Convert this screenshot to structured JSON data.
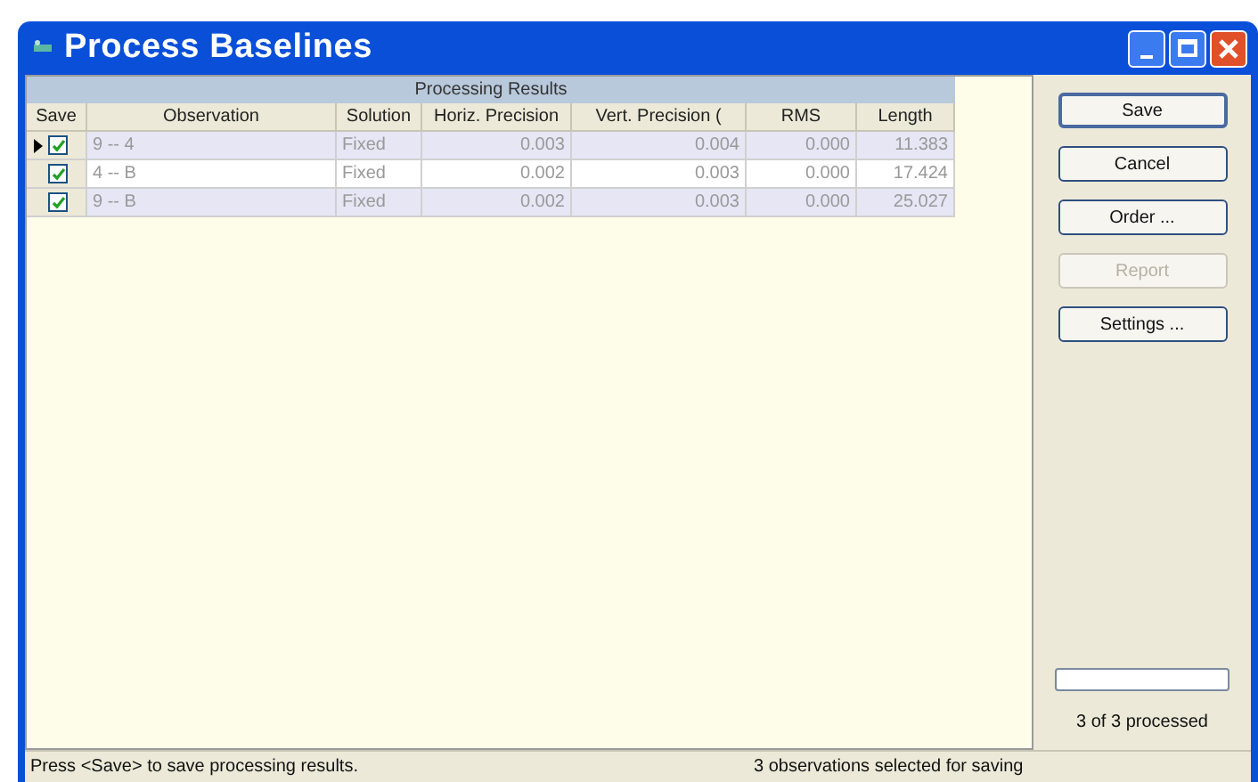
{
  "window": {
    "title": "Process Baselines"
  },
  "table": {
    "group_header": "Processing Results",
    "save_column": "Save",
    "columns": [
      "Observation",
      "Solution",
      "Horiz. Precision",
      "Vert. Precision (",
      "RMS",
      "Length"
    ],
    "rows": [
      {
        "current": true,
        "checked": true,
        "cells": [
          "9 -- 4",
          "Fixed",
          "0.003",
          "0.004",
          "0.000",
          "11.383"
        ]
      },
      {
        "current": false,
        "checked": true,
        "cells": [
          "4 -- B",
          "Fixed",
          "0.002",
          "0.003",
          "0.000",
          "17.424"
        ]
      },
      {
        "current": false,
        "checked": true,
        "cells": [
          "9 -- B",
          "Fixed",
          "0.002",
          "0.003",
          "0.000",
          "25.027"
        ]
      }
    ]
  },
  "buttons": [
    {
      "label": "Save",
      "default": true,
      "disabled": false
    },
    {
      "label": "Cancel",
      "default": false,
      "disabled": false
    },
    {
      "label": "Order ...",
      "default": false,
      "disabled": false
    },
    {
      "label": "Report",
      "default": false,
      "disabled": true
    },
    {
      "label": "Settings ...",
      "default": false,
      "disabled": false
    }
  ],
  "progress": {
    "reading": "3 of 3 processed"
  },
  "status_bar": [
    "Press <Save> to save processing results.",
    "3 observations selected for saving"
  ]
}
